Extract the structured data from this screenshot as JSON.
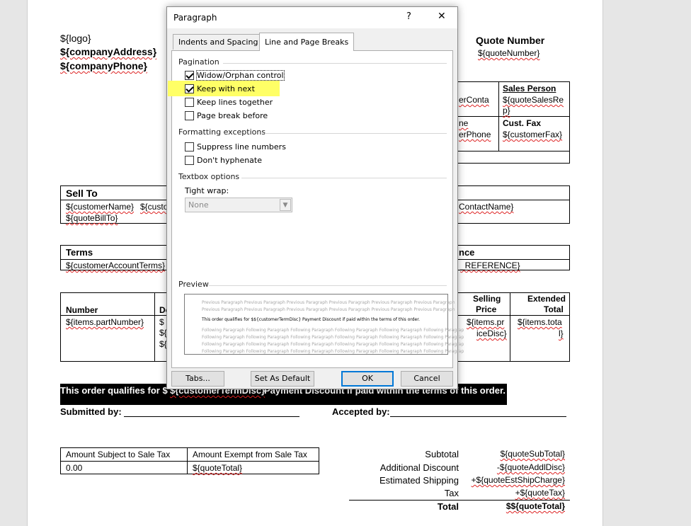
{
  "document": {
    "logo": "${logo}",
    "company_address": "${companyAddress}",
    "company_phone": "${companyPhone}",
    "quote_number_label": "Quote Number",
    "quote_number_value": "${quoteNumber}",
    "contact_partial": "erConta",
    "phone_partial_1": "ne",
    "phone_partial_2": "erPhone",
    "sales_person_label": "Sales Person",
    "sales_rep_line1": "${quoteSalesRe",
    "sales_rep_line2": "p}",
    "cust_fax_label": "Cust. Fax",
    "cust_fax_value": "${customerFax}",
    "sell_to_label": "Sell To",
    "customer_name": "${customerName}",
    "customer_partial": "${custo",
    "quote_bill_to": "${quoteBillTo}",
    "contact_name_partial": "ContactName}",
    "terms_label": "Terms",
    "customer_account_terms": "${customerAccountTerms}",
    "reference_header_partial": "nce",
    "reference_partial": "_REFERENCE}",
    "number_header": "Number",
    "desc_header_partial": "De",
    "part_number": "${items.partNumber}",
    "desc_partial_1": "$",
    "desc_partial_2": "${",
    "desc_partial_3": "${",
    "desc_partial_4": "${",
    "selling_price_header_1": "Selling",
    "selling_price_header_2": "Price",
    "extended_total_header_1": "Extended",
    "extended_total_header_2": "Total",
    "selling_price_line1": "${items.pr",
    "selling_price_line2": "iceDisc}",
    "extended_total_line1": "${items.tota",
    "extended_total_line2": "l}",
    "banner_left": "This order qualifies for $",
    "banner_hidden": "${customerTermDisc}",
    "banner_right": "Payment Discount if paid within the terms of this order.",
    "submitted_by_label": "Submitted by:",
    "accepted_by_label": "Accepted by:",
    "tax_table": {
      "headers": [
        "Amount Subject to Sale Tax",
        "Amount Exempt from Sale Tax"
      ],
      "values": [
        "0.00",
        "${quoteTotal}"
      ]
    },
    "totals": [
      {
        "label": "Subtotal",
        "value": "${quoteSubTotal}"
      },
      {
        "label": "Additional Discount",
        "value": "-${quoteAddlDisc}"
      },
      {
        "label": "Estimated Shipping",
        "value": "+${quoteEstShipCharge}"
      },
      {
        "label": "Tax",
        "value": "+${quoteTax}"
      },
      {
        "label": "Total",
        "value": "$${quoteTotal}"
      }
    ]
  },
  "dialog": {
    "title": "Paragraph",
    "help_label": "?",
    "close_label": "✕",
    "tabs": [
      "Indents and Spacing",
      "Line and Page Breaks"
    ],
    "active_tab": 1,
    "pagination_label": "Pagination",
    "pagination_options": [
      {
        "label": "Widow/Orphan control",
        "checked": true
      },
      {
        "label": "Keep with next",
        "checked": true
      },
      {
        "label": "Keep lines together",
        "checked": false
      },
      {
        "label": "Page break before",
        "checked": false
      }
    ],
    "formatting_label": "Formatting exceptions",
    "formatting_options": [
      {
        "label": "Suppress line numbers",
        "checked": false
      },
      {
        "label": "Don't hyphenate",
        "checked": false
      }
    ],
    "textbox_label": "Textbox options",
    "tight_wrap_label": "Tight wrap:",
    "tight_wrap_value": "None",
    "preview_label": "Preview",
    "preview_prev_1": "Previous Paragraph Previous Paragraph Previous Paragraph Previous Paragraph Previous Paragraph Previous Paragraph",
    "preview_prev_2": "Previous Paragraph Previous Paragraph Previous Paragraph Previous Paragraph Previous Paragraph Previous Paragraph",
    "preview_current": "This order qualifies for $${customerTermDisc} Payment Discount if paid within the terms of this order.",
    "preview_follow_1": "Following Paragraph Following Paragraph Following Paragraph Following Paragraph Following Paragraph Following Paragraph",
    "preview_follow_2": "Following Paragraph Following Paragraph Following Paragraph Following Paragraph Following Paragraph Following Paragraph",
    "preview_follow_3": "Following Paragraph Following Paragraph Following Paragraph Following Paragraph Following Paragraph Following Paragraph",
    "preview_follow_4": "Following Paragraph Following Paragraph Following Paragraph Following Paragraph Following Paragraph Following Paragraph",
    "tabs_button": "Tabs...",
    "set_default_button": "Set As Default",
    "ok_button": "OK",
    "cancel_button": "Cancel",
    "highlight_color": "#ffff66"
  }
}
